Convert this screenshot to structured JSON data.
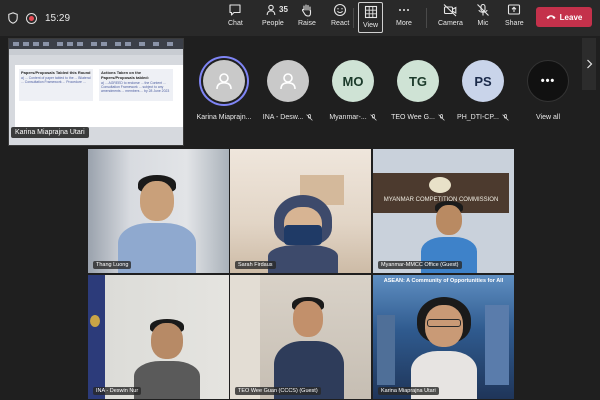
{
  "meeting": {
    "timer": "15:29",
    "people_count": "35",
    "toolbar": {
      "chat": "Chat",
      "people": "People",
      "raise": "Raise",
      "react": "React",
      "view": "View",
      "more": "More",
      "camera": "Camera",
      "mic": "Mic",
      "share": "Share",
      "leave": "Leave"
    }
  },
  "shared_screen": {
    "presenter": "Karina Miaprajna Utari",
    "doc": {
      "left_heading": "Papers/Proposals Tabled this Round",
      "left_text": "a) ... Content of paper tabled to the ... Bilateral ... Consultation Framework ... Procedure ...",
      "right_heading": "Actions Taken on the Papers/Proposals tabled:",
      "right_text": "a) ... AGREED to endorse ... the Content ... Consultation Framework ... subject to any amendments ... members ... by 28 June 2023"
    }
  },
  "participants_row": [
    {
      "name": "Karina Miaprajn...",
      "avatar": "person-icon",
      "color": "#c9c9c9",
      "active": true,
      "muted": false
    },
    {
      "name": "INA - Desw...",
      "avatar": "person-icon",
      "color": "#c9c9c9",
      "active": false,
      "muted": true
    },
    {
      "name": "Myanmar-...",
      "initials": "MO",
      "color": "#cfe3d5",
      "active": false,
      "muted": true
    },
    {
      "name": "TEO Wee G...",
      "initials": "TG",
      "color": "#cfe3d5",
      "active": false,
      "muted": true
    },
    {
      "name": "PH_DTI-CP...",
      "initials": "PS",
      "color": "#c9d4ea",
      "active": false,
      "muted": true
    },
    {
      "name": "View all",
      "icon": "more-icon",
      "color": "#111111"
    }
  ],
  "video_tiles": [
    {
      "name": "Thang Luong"
    },
    {
      "name": "Sarah Firdaus"
    },
    {
      "name": "Myanmar-MMCC Office (Guest)",
      "banner": "MYANMAR COMPETITION COMMISSION"
    },
    {
      "name": "INA - Deswin Nur"
    },
    {
      "name": "TEO Wee Guan (CCCS) (Guest)"
    },
    {
      "name": "Karina Miaprajna Utari",
      "banner": "ASEAN: A Community of Opportunities for All"
    }
  ]
}
